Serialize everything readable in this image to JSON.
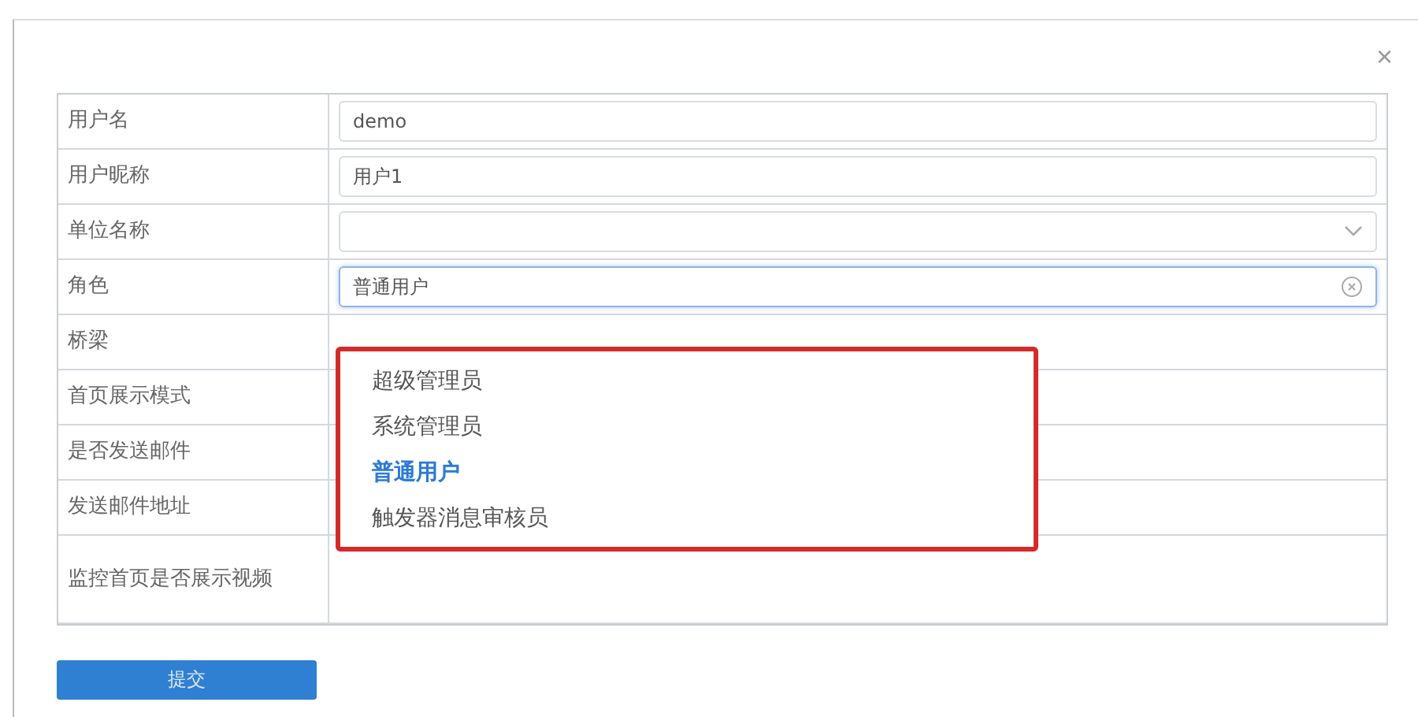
{
  "dialog": {
    "close": "×"
  },
  "rows": [
    {
      "label": "用户名",
      "kind": "input",
      "value": "demo"
    },
    {
      "label": "用户昵称",
      "kind": "input",
      "value": "用户1"
    },
    {
      "label": "单位名称",
      "kind": "select",
      "focused": false
    },
    {
      "label": "角色",
      "kind": "select",
      "value": "普通用户",
      "focused": true
    },
    {
      "label": "桥梁",
      "kind": "blank"
    },
    {
      "label": "首页展示模式",
      "kind": "blank"
    },
    {
      "label": "是否发送邮件",
      "kind": "blank"
    },
    {
      "label": "发送邮件地址",
      "kind": "blank"
    },
    {
      "label": "监控首页是否展示视频",
      "kind": "blank"
    }
  ],
  "dropdown": {
    "options": [
      {
        "label": "超级管理员",
        "selected": false
      },
      {
        "label": "系统管理员",
        "selected": false
      },
      {
        "label": "普通用户",
        "selected": true
      },
      {
        "label": "触发器消息审核员",
        "selected": false
      }
    ]
  },
  "submit": "提交"
}
